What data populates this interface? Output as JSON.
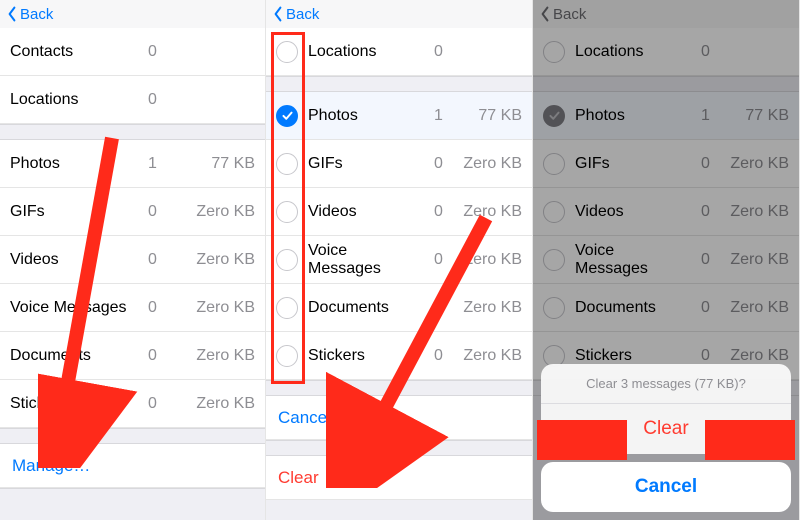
{
  "nav": {
    "back": "Back"
  },
  "pane1": {
    "groupA": [
      {
        "label": "Contacts",
        "count": "0",
        "size": ""
      },
      {
        "label": "Locations",
        "count": "0",
        "size": ""
      }
    ],
    "groupB": [
      {
        "label": "Photos",
        "count": "1",
        "size": "77 KB"
      },
      {
        "label": "GIFs",
        "count": "0",
        "size": "Zero KB"
      },
      {
        "label": "Videos",
        "count": "0",
        "size": "Zero KB"
      },
      {
        "label": "Voice Messages",
        "count": "0",
        "size": "Zero KB"
      },
      {
        "label": "Documents",
        "count": "0",
        "size": "Zero KB"
      },
      {
        "label": "Stickers",
        "count": "0",
        "size": "Zero KB"
      }
    ],
    "manage": "Manage…"
  },
  "pane2": {
    "rows": [
      {
        "label": "Locations",
        "count": "0",
        "size": "",
        "checked": false
      },
      {
        "label": "Photos",
        "count": "1",
        "size": "77 KB",
        "checked": true
      },
      {
        "label": "GIFs",
        "count": "0",
        "size": "Zero KB",
        "checked": false
      },
      {
        "label": "Videos",
        "count": "0",
        "size": "Zero KB",
        "checked": false
      },
      {
        "label": "Voice Messages",
        "count": "0",
        "size": "Zero KB",
        "checked": false
      },
      {
        "label": "Documents",
        "count": "0",
        "size": "Zero KB",
        "checked": false
      },
      {
        "label": "Stickers",
        "count": "0",
        "size": "Zero KB",
        "checked": false
      }
    ],
    "cancel": "Cancel",
    "clear": "Clear"
  },
  "pane3": {
    "rows": [
      {
        "label": "Locations",
        "count": "0",
        "size": "",
        "checked": false
      },
      {
        "label": "Photos",
        "count": "1",
        "size": "77 KB",
        "checked": true
      },
      {
        "label": "GIFs",
        "count": "0",
        "size": "Zero KB",
        "checked": false
      },
      {
        "label": "Videos",
        "count": "0",
        "size": "Zero KB",
        "checked": false
      },
      {
        "label": "Voice Messages",
        "count": "0",
        "size": "Zero KB",
        "checked": false
      },
      {
        "label": "Documents",
        "count": "0",
        "size": "Zero KB",
        "checked": false
      },
      {
        "label": "Stickers",
        "count": "0",
        "size": "Zero KB",
        "checked": false
      }
    ],
    "peek_clear": "Clear",
    "sheet_title": "Clear 3 messages (77 KB)?",
    "sheet_clear": "Clear",
    "sheet_cancel": "Cancel"
  }
}
